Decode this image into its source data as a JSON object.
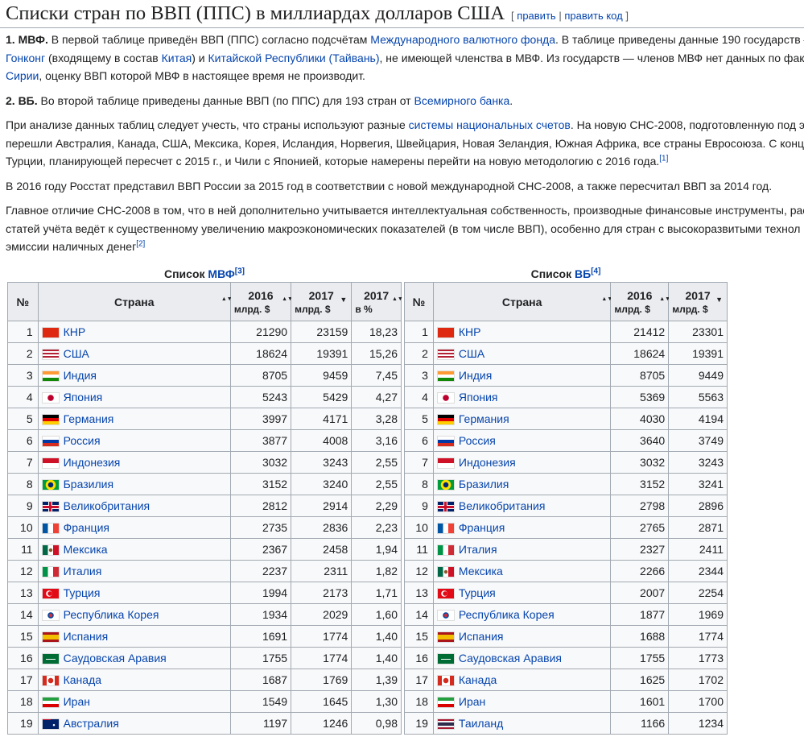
{
  "heading": {
    "title": "Списки стран по ВВП (ППС) в миллиардах долларов США",
    "open_bracket": "[",
    "edit": "править",
    "sep": "|",
    "edit_source": "править код",
    "close_bracket": "]"
  },
  "paragraphs": {
    "p1": {
      "bold": "1. МВФ.",
      "t1": " В первой таблице приведён ВВП (ППС) согласно подсчётам ",
      "l1": "Международного валютного фонда",
      "t2": ". В таблице приведены данные 190 государств — ",
      "l2": "Гонконг",
      "t3": " (входящему в состав ",
      "l3": "Китая",
      "t4": ") и ",
      "l4": "Китайской Республики (Тайвань)",
      "t5": ", не имеющей членства в МВФ. Из государств — членов МВФ нет данных по фак",
      "l5": "Сирии",
      "t6": ", оценку ВВП которой МВФ в настоящее время не производит."
    },
    "p2": {
      "bold": "2. ВБ.",
      "t1": " Во второй таблице приведены данные ВВП (по ППС) для 193 стран от ",
      "l1": "Всемирного банка",
      "t2": "."
    },
    "p3": {
      "t1": "При анализе данных таблиц следует учесть, что страны используют разные ",
      "l1": "системы национальных счетов",
      "t2": ". На новую СНС-2008, подготовленную под э",
      "line2": "перешли Австралия, Канада, США, Мексика, Корея, Исландия, Норвегия, Швейцария, Новая Зеландия, Южная Африка, все страны Евросоюза. С конц",
      "line3": "Турции, планирующей пересчет с 2015 г., и Чили с Японией, которые намерены перейти на новую методологию с 2016 года.",
      "ref": "[1]"
    },
    "p4": "В 2016 году Росстат представил ВВП России за 2015 год в соответствии с новой международной СНС-2008, а также пересчитал ВВП за 2014 год.",
    "p5": {
      "line1": "Главное отличие СНС-2008 в том, что в ней дополнительно учитывается интеллектуальная собственность, производные финансовые инструменты, рас",
      "line2": "статей учёта ведёт к существенному увеличению макроэкономических показателей (в том числе ВВП), особенно для стран с высокоразвитыми технол",
      "line3": "эмиссии наличных денег",
      "ref": "[2]"
    }
  },
  "imf": {
    "caption_text": "Список ",
    "caption_link": "МВФ",
    "caption_ref": "[3]",
    "headers": {
      "no": "№",
      "country": "Страна",
      "y2016": "2016",
      "y2016_sub": "млрд. $",
      "y2017": "2017",
      "y2017_sub": "млрд. $",
      "pct": "2017",
      "pct_sub": "в %"
    },
    "rows": [
      {
        "rank": "1",
        "country": "КНР",
        "flag": "cn",
        "v2016": "21290",
        "v2017": "23159",
        "pct": "18,23"
      },
      {
        "rank": "2",
        "country": "США",
        "flag": "us",
        "v2016": "18624",
        "v2017": "19391",
        "pct": "15,26"
      },
      {
        "rank": "3",
        "country": "Индия",
        "flag": "in",
        "v2016": "8705",
        "v2017": "9459",
        "pct": "7,45"
      },
      {
        "rank": "4",
        "country": "Япония",
        "flag": "jp",
        "v2016": "5243",
        "v2017": "5429",
        "pct": "4,27"
      },
      {
        "rank": "5",
        "country": "Германия",
        "flag": "de",
        "v2016": "3997",
        "v2017": "4171",
        "pct": "3,28"
      },
      {
        "rank": "6",
        "country": "Россия",
        "flag": "ru",
        "v2016": "3877",
        "v2017": "4008",
        "pct": "3,16"
      },
      {
        "rank": "7",
        "country": "Индонезия",
        "flag": "id",
        "v2016": "3032",
        "v2017": "3243",
        "pct": "2,55"
      },
      {
        "rank": "8",
        "country": "Бразилия",
        "flag": "br",
        "v2016": "3152",
        "v2017": "3240",
        "pct": "2,55"
      },
      {
        "rank": "9",
        "country": "Великобритания",
        "flag": "gb",
        "v2016": "2812",
        "v2017": "2914",
        "pct": "2,29"
      },
      {
        "rank": "10",
        "country": "Франция",
        "flag": "fr",
        "v2016": "2735",
        "v2017": "2836",
        "pct": "2,23"
      },
      {
        "rank": "11",
        "country": "Мексика",
        "flag": "mx",
        "v2016": "2367",
        "v2017": "2458",
        "pct": "1,94"
      },
      {
        "rank": "12",
        "country": "Италия",
        "flag": "it",
        "v2016": "2237",
        "v2017": "2311",
        "pct": "1,82"
      },
      {
        "rank": "13",
        "country": "Турция",
        "flag": "tr",
        "v2016": "1994",
        "v2017": "2173",
        "pct": "1,71"
      },
      {
        "rank": "14",
        "country": "Республика Корея",
        "flag": "kr",
        "v2016": "1934",
        "v2017": "2029",
        "pct": "1,60"
      },
      {
        "rank": "15",
        "country": "Испания",
        "flag": "es",
        "v2016": "1691",
        "v2017": "1774",
        "pct": "1,40"
      },
      {
        "rank": "16",
        "country": "Саудовская Аравия",
        "flag": "sa",
        "v2016": "1755",
        "v2017": "1774",
        "pct": "1,40"
      },
      {
        "rank": "17",
        "country": "Канада",
        "flag": "ca",
        "v2016": "1687",
        "v2017": "1769",
        "pct": "1,39"
      },
      {
        "rank": "18",
        "country": "Иран",
        "flag": "ir",
        "v2016": "1549",
        "v2017": "1645",
        "pct": "1,30"
      },
      {
        "rank": "19",
        "country": "Австралия",
        "flag": "au",
        "v2016": "1197",
        "v2017": "1246",
        "pct": "0,98"
      }
    ]
  },
  "wb": {
    "caption_text": "Список ",
    "caption_link": "ВБ",
    "caption_ref": "[4]",
    "headers": {
      "no": "№",
      "country": "Страна",
      "y2016": "2016",
      "y2016_sub": "млрд. $",
      "y2017": "2017",
      "y2017_sub": "млрд. $"
    },
    "rows": [
      {
        "rank": "1",
        "country": "КНР",
        "flag": "cn",
        "v2016": "21412",
        "v2017": "23301"
      },
      {
        "rank": "2",
        "country": "США",
        "flag": "us",
        "v2016": "18624",
        "v2017": "19391"
      },
      {
        "rank": "3",
        "country": "Индия",
        "flag": "in",
        "v2016": "8705",
        "v2017": "9449"
      },
      {
        "rank": "4",
        "country": "Япония",
        "flag": "jp",
        "v2016": "5369",
        "v2017": "5563"
      },
      {
        "rank": "5",
        "country": "Германия",
        "flag": "de",
        "v2016": "4030",
        "v2017": "4194"
      },
      {
        "rank": "6",
        "country": "Россия",
        "flag": "ru",
        "v2016": "3640",
        "v2017": "3749"
      },
      {
        "rank": "7",
        "country": "Индонезия",
        "flag": "id",
        "v2016": "3032",
        "v2017": "3243"
      },
      {
        "rank": "8",
        "country": "Бразилия",
        "flag": "br",
        "v2016": "3152",
        "v2017": "3241"
      },
      {
        "rank": "9",
        "country": "Великобритания",
        "flag": "gb",
        "v2016": "2798",
        "v2017": "2896"
      },
      {
        "rank": "10",
        "country": "Франция",
        "flag": "fr",
        "v2016": "2765",
        "v2017": "2871"
      },
      {
        "rank": "11",
        "country": "Италия",
        "flag": "it",
        "v2016": "2327",
        "v2017": "2411"
      },
      {
        "rank": "12",
        "country": "Мексика",
        "flag": "mx",
        "v2016": "2266",
        "v2017": "2344"
      },
      {
        "rank": "13",
        "country": "Турция",
        "flag": "tr",
        "v2016": "2007",
        "v2017": "2254"
      },
      {
        "rank": "14",
        "country": "Республика Корея",
        "flag": "kr",
        "v2016": "1877",
        "v2017": "1969"
      },
      {
        "rank": "15",
        "country": "Испания",
        "flag": "es",
        "v2016": "1688",
        "v2017": "1774"
      },
      {
        "rank": "16",
        "country": "Саудовская Аравия",
        "flag": "sa",
        "v2016": "1755",
        "v2017": "1773"
      },
      {
        "rank": "17",
        "country": "Канада",
        "flag": "ca",
        "v2016": "1625",
        "v2017": "1702"
      },
      {
        "rank": "18",
        "country": "Иран",
        "flag": "ir",
        "v2016": "1601",
        "v2017": "1700"
      },
      {
        "rank": "19",
        "country": "Таиланд",
        "flag": "th",
        "v2016": "1166",
        "v2017": "1234"
      }
    ]
  },
  "sort_icons": {
    "both": "▲▼",
    "down": "▼"
  }
}
